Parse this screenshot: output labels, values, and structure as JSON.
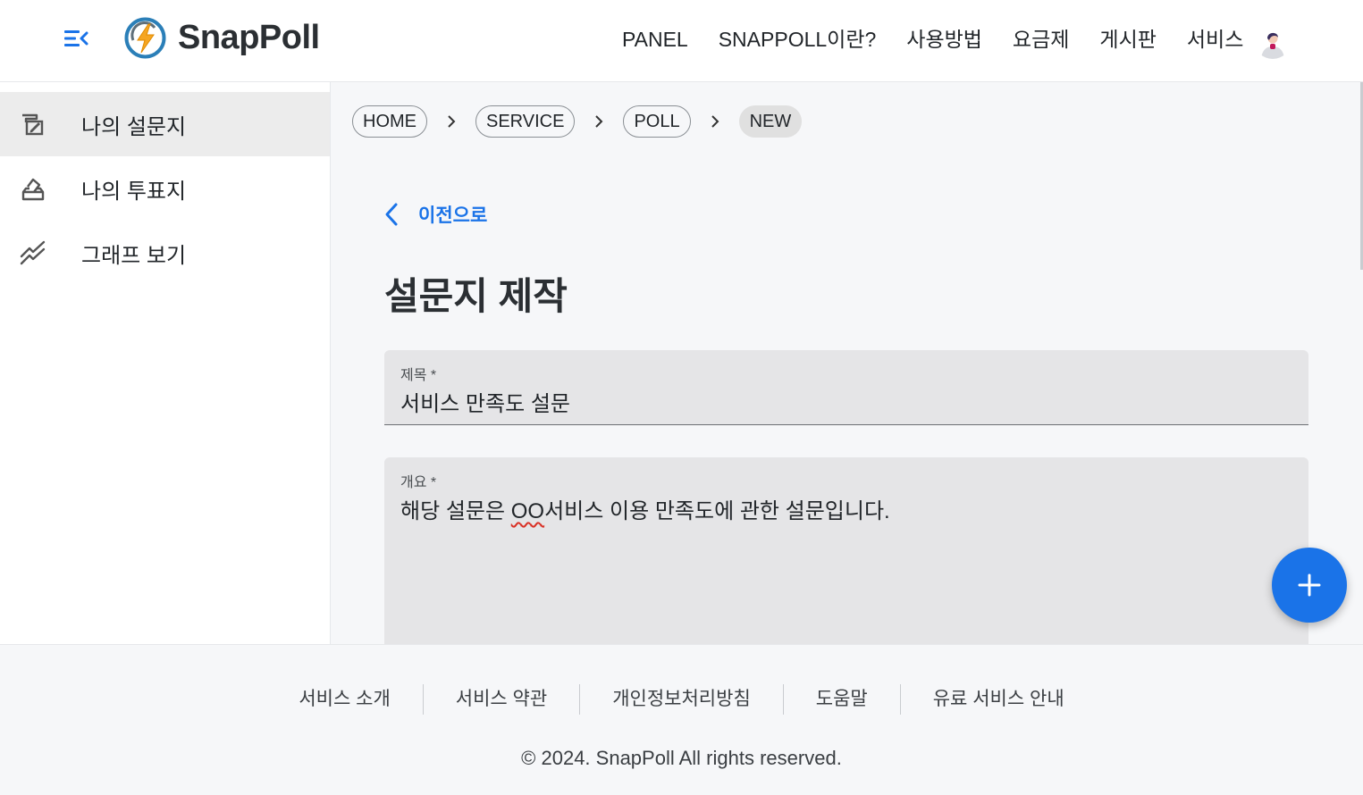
{
  "header": {
    "logo_text": "SnapPoll",
    "nav": [
      "PANEL",
      "SNAPPOLL이란?",
      "사용방법",
      "요금제",
      "게시판",
      "서비스"
    ]
  },
  "sidebar": {
    "items": [
      {
        "label": "나의 설문지",
        "icon": "survey-edit-icon",
        "active": true
      },
      {
        "label": "나의 투표지",
        "icon": "ballot-box-icon",
        "active": false
      },
      {
        "label": "그래프 보기",
        "icon": "trend-chart-icon",
        "active": false
      }
    ]
  },
  "breadcrumb": [
    "HOME",
    "SERVICE",
    "POLL",
    "NEW"
  ],
  "back_label": "이전으로",
  "page_title": "설문지 제작",
  "form": {
    "title_label": "제목 *",
    "title_value": "서비스 만족도 설문",
    "summary_label": "개요 *",
    "summary_before": "해당 설문은 ",
    "summary_misspelled": "OO",
    "summary_after": "서비스 이용 만족도에 관한 설문입니다."
  },
  "footer": {
    "links": [
      "서비스 소개",
      "서비스 약관",
      "개인정보처리방침",
      "도움말",
      "유료 서비스 안내"
    ],
    "copyright": "© 2024. SnapPoll All rights reserved."
  },
  "colors": {
    "accent": "#1a73e8",
    "logo_ring": "#2b7fb8",
    "logo_bolt": "#f5a623"
  }
}
